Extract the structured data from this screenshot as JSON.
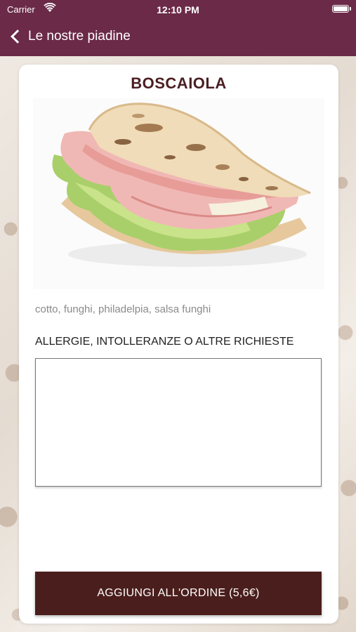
{
  "status_bar": {
    "carrier": "Carrier",
    "time": "12:10 PM",
    "icons": [
      "wifi-icon",
      "battery-icon"
    ]
  },
  "nav": {
    "back_label": "Le nostre piadine",
    "bar_color": "#6b2a48"
  },
  "product": {
    "name": "BOSCAIOLA",
    "ingredients": "cotto, funghi, philadelpia, salsa funghi",
    "image": "piadina-photo"
  },
  "notes": {
    "label": "ALLERGIE, INTOLLERANZE O ALTRE RICHIESTE",
    "value": "",
    "placeholder": ""
  },
  "actions": {
    "add_label": "AGGIUNGI ALL'ORDINE (5,6€)",
    "button_color": "#4a1e1c"
  }
}
